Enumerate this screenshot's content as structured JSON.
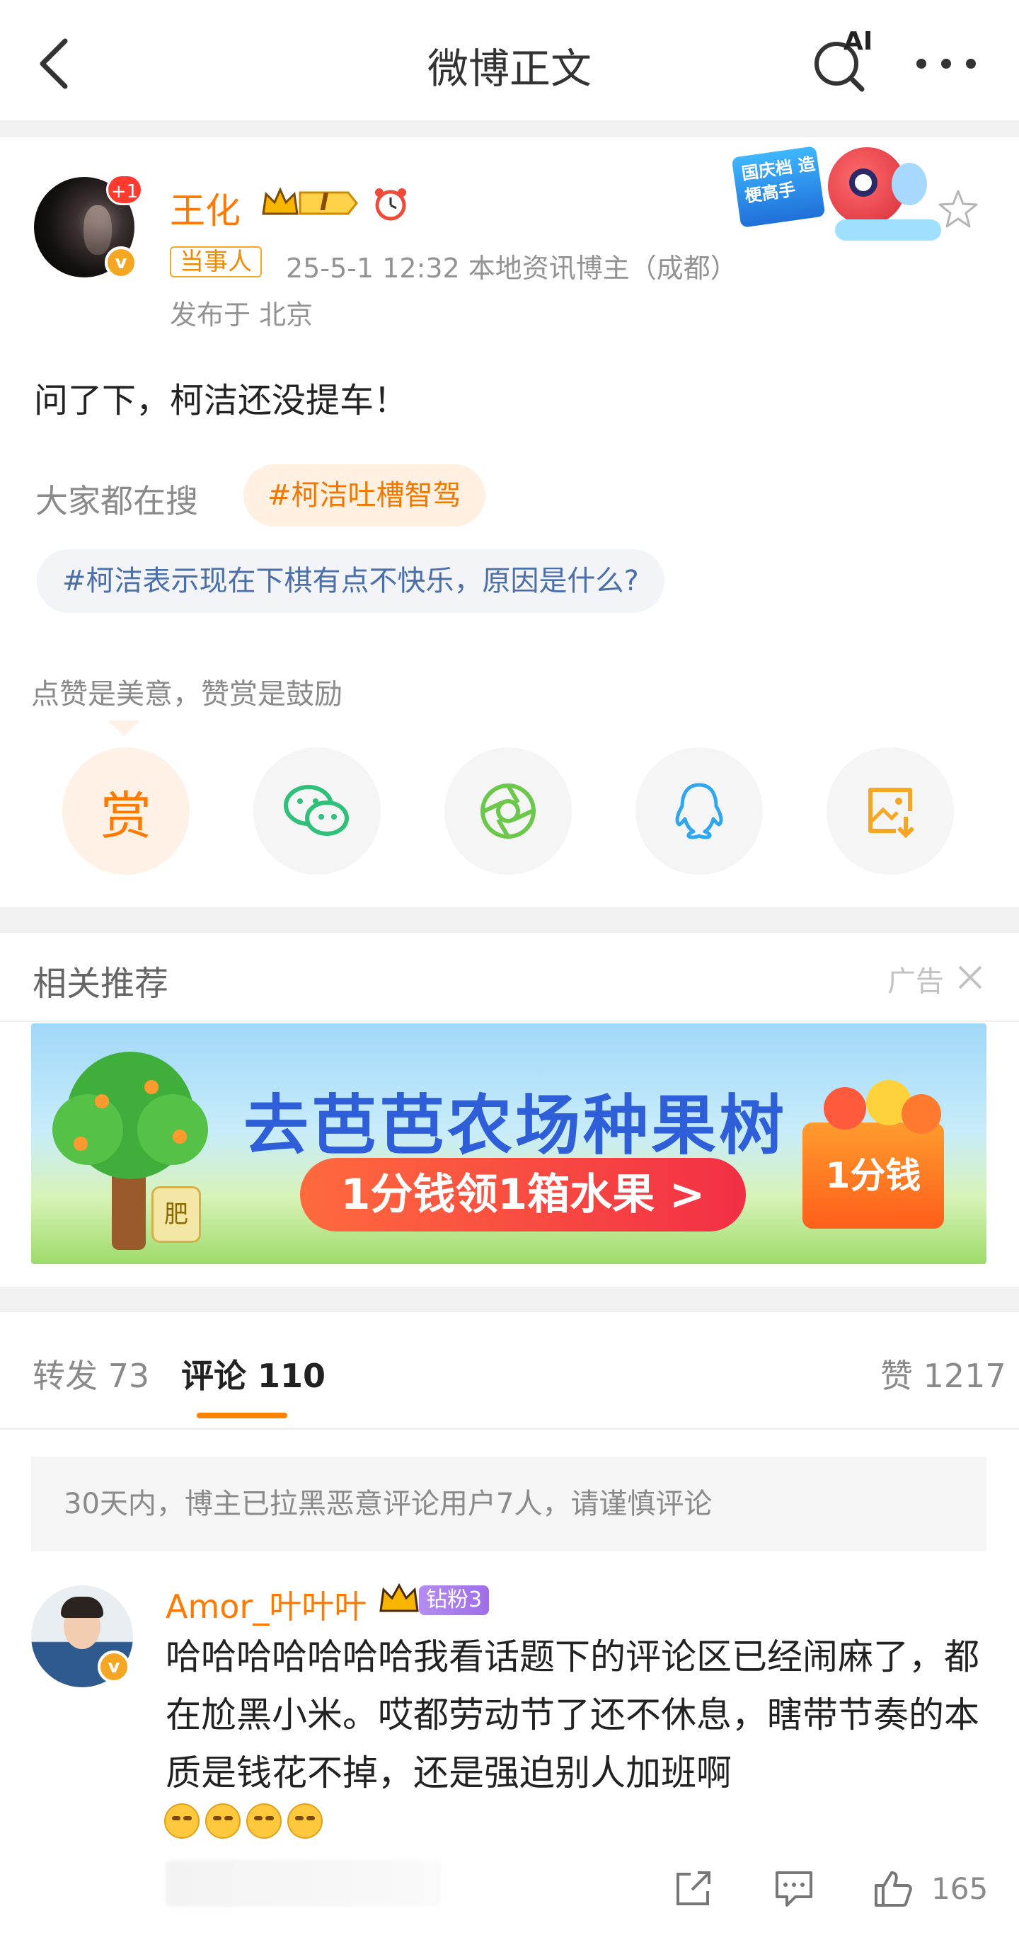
{
  "nav": {
    "title": "微博正文",
    "ai_label": "AI"
  },
  "post": {
    "username": "王化",
    "avatar_plus": "+1",
    "level_badge": "I",
    "tag": "当事人",
    "meta": "25-5-1 12:32   本地资讯博主（成都）",
    "location": "发布于 北京",
    "ad_badge_text": "国庆档 造梗高手",
    "content": "问了下，柯洁还没提车！",
    "search_label": "大家都在搜",
    "hot_tag": "#柯洁吐槽智驾",
    "topic": "#柯洁表示现在下棋有点不快乐，原因是什么?",
    "reward_hint": "点赞是美意，赞赏是鼓励",
    "reward_label": "赏"
  },
  "share_buttons": [
    "reward",
    "wechat",
    "moments",
    "qq",
    "save-image"
  ],
  "recommend": {
    "title": "相关推荐",
    "ad_label": "广告",
    "banner_title": "去芭芭农场种果树",
    "banner_pill": "1分钱领1箱水果 >",
    "banner_box": "1分钱",
    "banner_bag": "肥"
  },
  "tabs": {
    "repost": "转发 73",
    "comments": "评论 110",
    "likes": "赞 1217"
  },
  "notice": "30天内，博主已拉黑恶意评论用户7人，请谨慎评论",
  "comment": {
    "username": "Amor_叶叶叶",
    "fan_badge": "钻粉3",
    "text": "哈哈哈哈哈哈哈我看话题下的评论区已经闹麻了，都在尬黑小米。哎都劳动节了还不休息，瞎带节奏的本质是钱花不掉，还是强迫别人加班啊",
    "emoji_count": 4,
    "likes": "165"
  },
  "colors": {
    "accent": "#ff8200",
    "username": "#ff7a00",
    "topic": "#4b6fa8",
    "gap": "#f2f2f2"
  }
}
